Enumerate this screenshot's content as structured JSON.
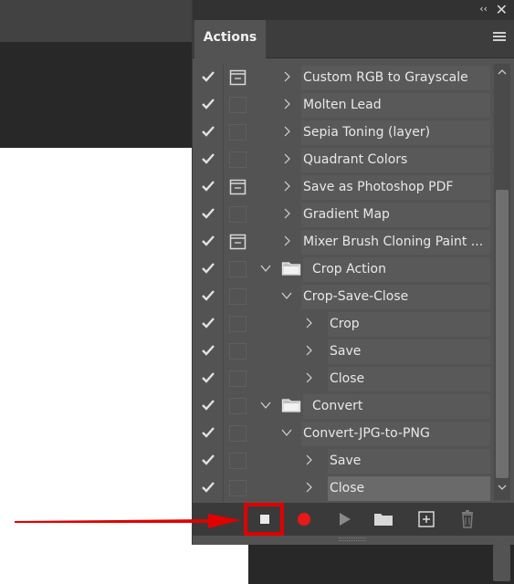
{
  "panel": {
    "tab_label": "Actions",
    "collapse_glyph": "‹‹",
    "close_glyph": "✕"
  },
  "rows": [
    {
      "label": "Custom RGB to Grayscale",
      "checked": true,
      "dialog": true,
      "indent": 1,
      "twisty": "closed",
      "folder": false
    },
    {
      "label": "Molten Lead",
      "checked": true,
      "dialog": false,
      "indent": 1,
      "twisty": "closed",
      "folder": false
    },
    {
      "label": "Sepia Toning (layer)",
      "checked": true,
      "dialog": false,
      "indent": 1,
      "twisty": "closed",
      "folder": false
    },
    {
      "label": "Quadrant Colors",
      "checked": true,
      "dialog": false,
      "indent": 1,
      "twisty": "closed",
      "folder": false
    },
    {
      "label": "Save as Photoshop PDF",
      "checked": true,
      "dialog": true,
      "indent": 1,
      "twisty": "closed",
      "folder": false
    },
    {
      "label": "Gradient Map",
      "checked": true,
      "dialog": false,
      "indent": 1,
      "twisty": "closed",
      "folder": false
    },
    {
      "label": "Mixer Brush Cloning Paint ...",
      "checked": true,
      "dialog": true,
      "indent": 1,
      "twisty": "closed",
      "folder": false
    },
    {
      "label": "Crop Action",
      "checked": true,
      "dialog": false,
      "indent": 0,
      "twisty": "open",
      "folder": true
    },
    {
      "label": "Crop-Save-Close",
      "checked": true,
      "dialog": false,
      "indent": 1,
      "twisty": "open",
      "folder": false
    },
    {
      "label": "Crop",
      "checked": true,
      "dialog": false,
      "indent": 2,
      "twisty": "closed",
      "folder": false
    },
    {
      "label": "Save",
      "checked": true,
      "dialog": false,
      "indent": 2,
      "twisty": "closed",
      "folder": false
    },
    {
      "label": "Close",
      "checked": true,
      "dialog": false,
      "indent": 2,
      "twisty": "closed",
      "folder": false
    },
    {
      "label": "Convert",
      "checked": true,
      "dialog": false,
      "indent": 0,
      "twisty": "open",
      "folder": true
    },
    {
      "label": "Convert-JPG-to-PNG",
      "checked": true,
      "dialog": false,
      "indent": 1,
      "twisty": "open",
      "folder": false
    },
    {
      "label": "Save",
      "checked": true,
      "dialog": false,
      "indent": 2,
      "twisty": "closed",
      "folder": false
    },
    {
      "label": "Close",
      "checked": true,
      "dialog": false,
      "indent": 2,
      "twisty": "closed",
      "folder": false,
      "selected": true
    }
  ],
  "toolbar": {
    "buttons": [
      "stop-icon",
      "record-icon",
      "play-icon",
      "folder-icon",
      "new-action-icon",
      "trash-icon"
    ]
  },
  "colors": {
    "highlight": "#e00000",
    "record": "#e81818",
    "arrow": "#e00000"
  }
}
